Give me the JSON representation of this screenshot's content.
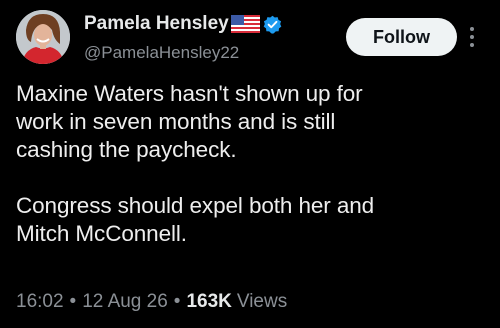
{
  "author": {
    "display_name": "Pamela Hensley",
    "handle": "@PamelaHensley22",
    "flag_icon": "us-flag-icon",
    "verified_icon": "verified-badge-icon",
    "verified_color": "#1d9bf0"
  },
  "actions": {
    "follow_label": "Follow",
    "more_icon": "more-vertical-icon"
  },
  "tweet": {
    "text": "Maxine Waters hasn't shown up for\nwork in seven months and is still\ncashing the paycheck.\n\nCongress should expel both her and\nMitch McConnell."
  },
  "meta": {
    "time": "16:02",
    "separator": "•",
    "date": "12 Aug 26",
    "views_count": "163K",
    "views_label": "Views"
  },
  "colors": {
    "background": "#000000",
    "text_primary": "#e7e9ea",
    "text_secondary": "#8b9096",
    "button_bg": "#eff3f4",
    "button_text": "#0f1419"
  }
}
